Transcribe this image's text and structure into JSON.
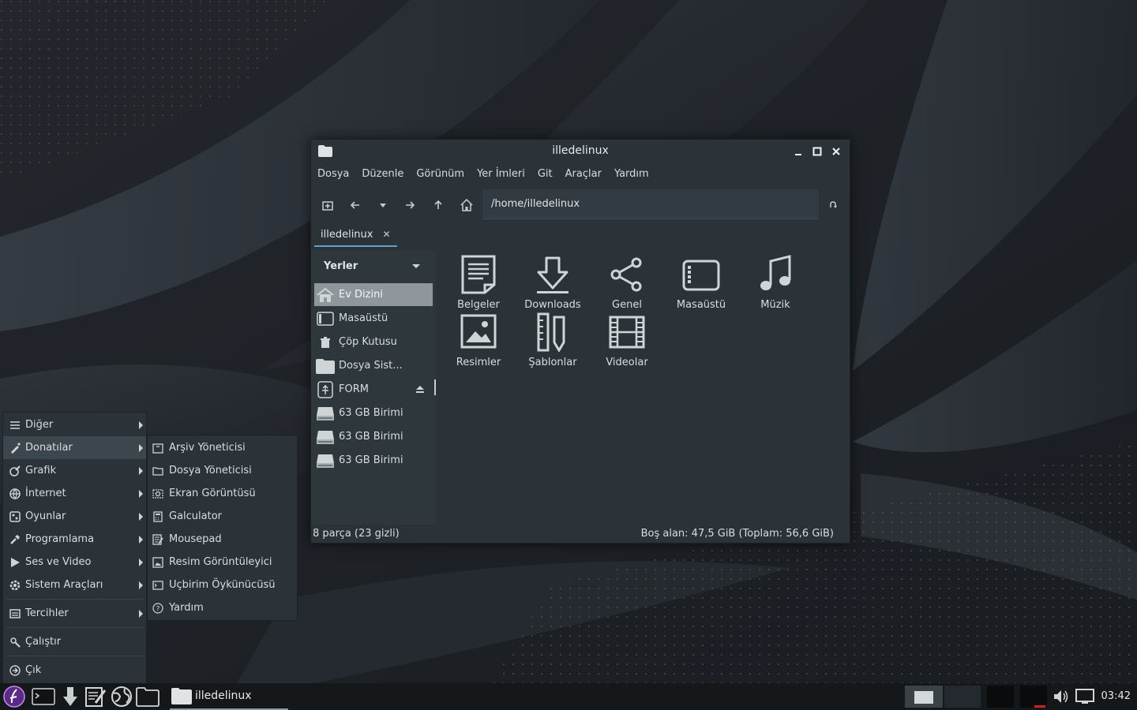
{
  "colors": {
    "window_bg": "#2b3338",
    "sidebar_bg": "#2e373c",
    "accent": "#5fa0c8",
    "taskbar_bg": "#15181b",
    "selected": "#8f979c"
  },
  "window": {
    "title": "illedelinux",
    "menu": [
      "Dosya",
      "Düzenle",
      "Görünüm",
      "Yer İmleri",
      "Git",
      "Araçlar",
      "Yardım"
    ],
    "location": "/home/illedelinux",
    "tab": "illedelinux",
    "toolbar_icons": [
      "new-window-icon",
      "back-icon",
      "history-dropdown-icon",
      "forward-icon",
      "up-icon",
      "home-icon",
      "reload-icon"
    ],
    "sidebar": {
      "header": "Yerler",
      "items": [
        {
          "label": "Ev Dizini",
          "icon": "home-folder-icon",
          "active": true
        },
        {
          "label": "Masaüstü",
          "icon": "desktop-icon"
        },
        {
          "label": "Çöp Kutusu",
          "icon": "trash-icon"
        },
        {
          "label": "Dosya Sist...",
          "icon": "filesystem-icon"
        },
        {
          "label": "FORM",
          "icon": "usb-drive-icon",
          "eject": true
        },
        {
          "label": "63 GB Birimi",
          "icon": "drive-icon"
        },
        {
          "label": "63 GB Birimi",
          "icon": "drive-icon"
        },
        {
          "label": "63 GB Birimi",
          "icon": "drive-icon"
        }
      ]
    },
    "files": [
      {
        "name": "Belgeler",
        "icon": "documents-folder-icon"
      },
      {
        "name": "Downloads",
        "icon": "downloads-folder-icon"
      },
      {
        "name": "Genel",
        "icon": "public-folder-icon"
      },
      {
        "name": "Masaüstü",
        "icon": "desktop-folder-icon"
      },
      {
        "name": "Müzik",
        "icon": "music-folder-icon"
      },
      {
        "name": "Resimler",
        "icon": "pictures-folder-icon"
      },
      {
        "name": "Şablonlar",
        "icon": "templates-folder-icon"
      },
      {
        "name": "Videolar",
        "icon": "videos-folder-icon"
      }
    ],
    "status_left": "8 parça (23 gizli)",
    "status_right": "Boş alan: 47,5 GiB (Toplam: 56,6 GiB)"
  },
  "app_menu": {
    "items": [
      {
        "label": "Diğer",
        "icon": "other-icon",
        "submenu": true
      },
      {
        "label": "Donatılar",
        "icon": "accessories-icon",
        "submenu": true,
        "hover": true
      },
      {
        "label": "Grafik",
        "icon": "graphics-icon",
        "submenu": true
      },
      {
        "label": "İnternet",
        "icon": "internet-icon",
        "submenu": true
      },
      {
        "label": "Oyunlar",
        "icon": "games-icon",
        "submenu": true
      },
      {
        "label": "Programlama",
        "icon": "programming-icon",
        "submenu": true
      },
      {
        "label": "Ses ve Video",
        "icon": "multimedia-icon",
        "submenu": true
      },
      {
        "label": "Sistem Araçları",
        "icon": "system-tools-icon",
        "submenu": true
      },
      {
        "label": "Tercihler",
        "icon": "preferences-icon",
        "submenu": true
      },
      {
        "label": "Çalıştır",
        "icon": "run-icon"
      },
      {
        "label": "Çık",
        "icon": "logout-icon"
      }
    ],
    "submenu": [
      {
        "label": "Arşiv Yöneticisi",
        "icon": "archive-manager-icon"
      },
      {
        "label": "Dosya Yöneticisi",
        "icon": "file-manager-icon"
      },
      {
        "label": "Ekran Görüntüsü",
        "icon": "screenshot-icon"
      },
      {
        "label": "Galculator",
        "icon": "calculator-icon"
      },
      {
        "label": "Mousepad",
        "icon": "text-editor-icon"
      },
      {
        "label": "Resim Görüntüleyici",
        "icon": "image-viewer-icon"
      },
      {
        "label": "Uçbirim Öykünücüsü",
        "icon": "terminal-icon"
      },
      {
        "label": "Yardım",
        "icon": "help-icon"
      }
    ]
  },
  "taskbar": {
    "task_label": "illedelinux",
    "clock": "03:42"
  }
}
